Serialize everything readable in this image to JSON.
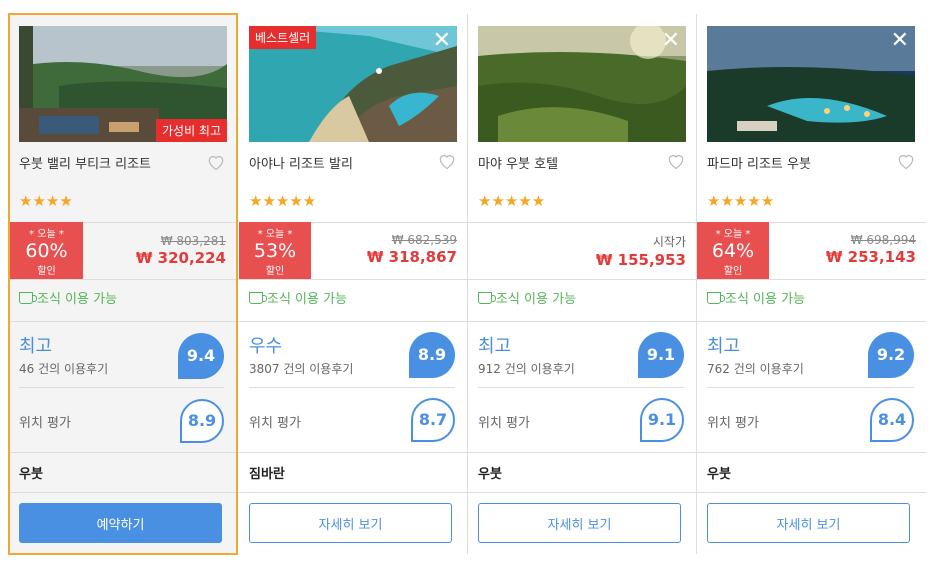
{
  "hotels": [
    {
      "name": "우붓 밸리 부티크 리조트",
      "badge_value": "가성비 최고",
      "stars": "★★★★",
      "deal_today": "* 오늘 *",
      "deal_pct": "60%",
      "deal_off": "할인",
      "orig_price": "₩ 803,281",
      "sale_price": "₩ 320,224",
      "breakfast": "조식 이용 가능",
      "rating_word": "최고",
      "review_count": "46 건의 이용후기",
      "score": "9.4",
      "location_label": "위치 평가",
      "location_score": "8.9",
      "area": "우붓",
      "button": "예약하기"
    },
    {
      "name": "아야나 리조트 발리",
      "badge_best": "베스트셀러",
      "stars": "★★★★★",
      "deal_today": "* 오늘 *",
      "deal_pct": "53%",
      "deal_off": "할인",
      "orig_price": "₩ 682,539",
      "sale_price": "₩ 318,867",
      "breakfast": "조식 이용 가능",
      "rating_word": "우수",
      "review_count": "3807 건의 이용후기",
      "score": "8.9",
      "location_label": "위치 평가",
      "location_score": "8.7",
      "area": "짐바란",
      "button": "자세히 보기"
    },
    {
      "name": "마야 우붓 호텔",
      "stars": "★★★★★",
      "start_label": "시작가",
      "sale_price": "₩ 155,953",
      "breakfast": "조식 이용 가능",
      "rating_word": "최고",
      "review_count": "912 건의 이용후기",
      "score": "9.1",
      "location_label": "위치 평가",
      "location_score": "9.1",
      "area": "우붓",
      "button": "자세히 보기"
    },
    {
      "name": "파드마 리조트 우붓",
      "stars": "★★★★★",
      "deal_today": "* 오늘 *",
      "deal_pct": "64%",
      "deal_off": "할인",
      "orig_price": "₩ 698,994",
      "sale_price": "₩ 253,143",
      "breakfast": "조식 이용 가능",
      "rating_word": "최고",
      "review_count": "762 건의 이용후기",
      "score": "9.2",
      "location_label": "위치 평가",
      "location_score": "8.4",
      "area": "우붓",
      "button": "자세히 보기"
    }
  ],
  "colors": {
    "accent": "#4a90e2",
    "deal": "#e85050",
    "price": "#e23b3b",
    "highlight_border": "#f0a830",
    "breakfast": "#55b55a"
  }
}
